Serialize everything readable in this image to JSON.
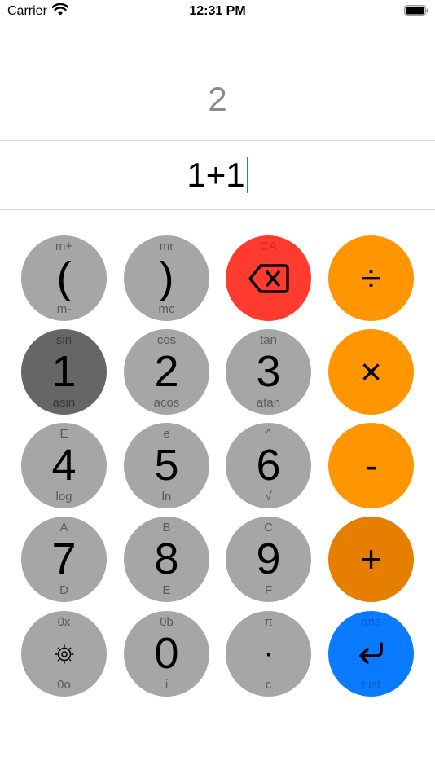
{
  "status_bar": {
    "carrier": "Carrier",
    "time": "12:31 PM"
  },
  "display": {
    "result": "2",
    "expression": "1+1"
  },
  "keys": {
    "paren_open": {
      "top": "m+",
      "main": "(",
      "bottom": "m-"
    },
    "paren_close": {
      "top": "mr",
      "main": ")",
      "bottom": "mc"
    },
    "backspace": {
      "top": "CA",
      "icon": "backspace-icon"
    },
    "divide": {
      "main": "÷"
    },
    "one": {
      "top": "sin",
      "main": "1",
      "bottom": "asin"
    },
    "two": {
      "top": "cos",
      "main": "2",
      "bottom": "acos"
    },
    "three": {
      "top": "tan",
      "main": "3",
      "bottom": "atan"
    },
    "multiply": {
      "main": "×"
    },
    "four": {
      "top": "E",
      "main": "4",
      "bottom": "log"
    },
    "five": {
      "top": "e",
      "main": "5",
      "bottom": "ln"
    },
    "six": {
      "top": "^",
      "main": "6",
      "bottom": "√"
    },
    "minus": {
      "main": "-"
    },
    "seven": {
      "top": "A",
      "main": "7",
      "bottom": "D"
    },
    "eight": {
      "top": "B",
      "main": "8",
      "bottom": "E"
    },
    "nine": {
      "top": "C",
      "main": "9",
      "bottom": "F"
    },
    "plus": {
      "main": "+"
    },
    "settings": {
      "top": "0x",
      "icon": "gear-icon",
      "bottom": "0o"
    },
    "zero": {
      "top": "0b",
      "main": "0",
      "bottom": "i"
    },
    "dot": {
      "top": "π",
      "main": "·",
      "bottom": "c"
    },
    "enter": {
      "top": "ans",
      "icon": "return-icon",
      "bottom": "hist"
    }
  },
  "colors": {
    "number_key": "#a6a6a6",
    "pressed_key": "#666666",
    "backspace_key": "#ff3b30",
    "operator_key": "#ff9500",
    "active_operator_key": "#e67e00",
    "enter_key": "#0a7aff",
    "caret": "#1f7aef"
  }
}
